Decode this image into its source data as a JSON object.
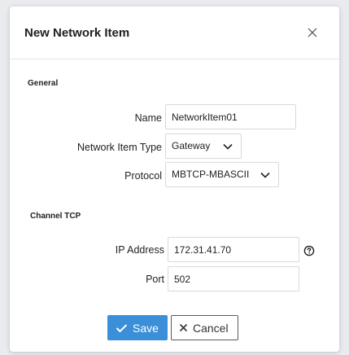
{
  "dialog": {
    "title": "New Network Item",
    "close_icon": "close-icon"
  },
  "general": {
    "section_label": "General",
    "name_label": "Name",
    "name_value": "NetworkItem01",
    "type_label": "Network Item Type",
    "type_value": "Gateway",
    "protocol_label": "Protocol",
    "protocol_value": "MBTCP-MBASCII"
  },
  "channel": {
    "section_label": "Channel TCP",
    "ip_label": "IP Address",
    "ip_value": "172.31.41.70",
    "port_label": "Port",
    "port_value": "502",
    "help_icon": "help-circle-icon"
  },
  "footer": {
    "save_label": "Save",
    "cancel_label": "Cancel",
    "save_icon": "check-icon",
    "cancel_icon": "x-icon"
  },
  "colors": {
    "primary": "#3a8fd8",
    "border": "#d6d9dd",
    "backdrop": "#e9ebef"
  }
}
